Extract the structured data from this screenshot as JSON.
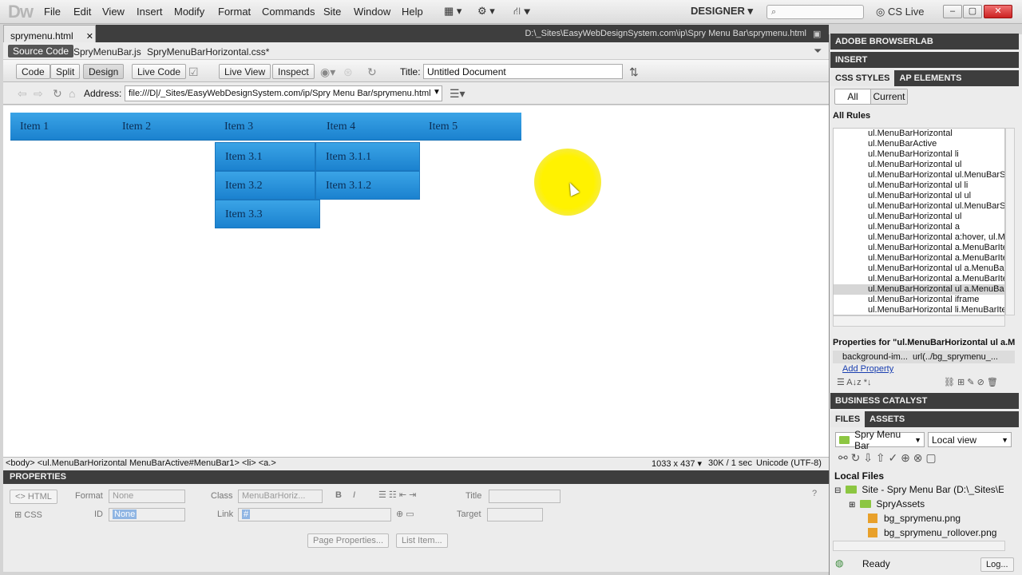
{
  "menubar": {
    "logo": "Dw",
    "items": [
      "File",
      "Edit",
      "View",
      "Insert",
      "Modify",
      "Format",
      "Commands",
      "Site",
      "Window",
      "Help"
    ],
    "workspace": "DESIGNER",
    "cslive": "CS Live"
  },
  "document": {
    "tab": "sprymenu.html",
    "path": "D:\\_Sites\\EasyWebDesignSystem.com\\ip\\Spry Menu Bar\\sprymenu.html",
    "related": [
      "Source Code",
      "SpryMenuBar.js",
      "SpryMenuBarHorizontal.css*"
    ],
    "toolbar": {
      "buttons": [
        "Code",
        "Split",
        "Design",
        "Live Code",
        "Live View",
        "Inspect"
      ],
      "title_label": "Title:",
      "title_value": "Untitled Document"
    },
    "address_label": "Address:",
    "address_value": "file:///D|/_Sites/EasyWebDesignSystem.com/ip/Spry Menu Bar/sprymenu.html"
  },
  "spry_menu": {
    "top": [
      "Item 1",
      "Item 2",
      "Item 3",
      "Item 4",
      "Item 5"
    ],
    "sub3": [
      "Item 3.1",
      "Item 3.2",
      "Item 3.3"
    ],
    "sub31": [
      "Item 3.1.1",
      "Item 3.1.2"
    ]
  },
  "status": {
    "tag_selector": "<body> <ul.MenuBarHorizontal MenuBarActive#MenuBar1> <li> <a.>",
    "size": "1033 x 437",
    "weight": "30K / 1 sec",
    "encoding": "Unicode (UTF-8)"
  },
  "properties": {
    "title": "PROPERTIES",
    "html_btn": "HTML",
    "css_btn": "CSS",
    "format_label": "Format",
    "format_value": "None",
    "id_label": "ID",
    "id_value": "None",
    "class_label": "Class",
    "class_value": "MenuBarHoriz...",
    "link_label": "Link",
    "link_value": "#",
    "title_label": "Title",
    "target_label": "Target",
    "page_props_btn": "Page Properties...",
    "list_item_btn": "List Item..."
  },
  "right_panel": {
    "browserlab": "ADOBE BROWSERLAB",
    "insert": "INSERT",
    "css_styles_tab": "CSS STYLES",
    "ap_elements_tab": "AP ELEMENTS",
    "all_btn": "All",
    "current_btn": "Current",
    "all_rules": "All Rules",
    "rules": [
      "ul.MenuBarHorizontal",
      "ul.MenuBarActive",
      "ul.MenuBarHorizontal li",
      "ul.MenuBarHorizontal ul",
      "ul.MenuBarHorizontal ul.MenuBarSu",
      "ul.MenuBarHorizontal ul li",
      "ul.MenuBarHorizontal ul ul",
      "ul.MenuBarHorizontal ul.MenuBarSu",
      "ul.MenuBarHorizontal ul",
      "ul.MenuBarHorizontal a",
      "ul.MenuBarHorizontal a:hover, ul.M",
      "ul.MenuBarHorizontal a.MenuBarIte",
      "ul.MenuBarHorizontal a.MenuBarIte",
      "ul.MenuBarHorizontal ul a.MenuBar",
      "ul.MenuBarHorizontal a.MenuBarIte",
      "ul.MenuBarHorizontal ul a.MenuBar",
      "ul.MenuBarHorizontal iframe",
      "ul.MenuBarHorizontal li.MenuBarIte"
    ],
    "props_for": "Properties for \"ul.MenuBarHorizontal ul a.M...",
    "prop_name": "background-im...",
    "prop_value": "url(../bg_sprymenu_...",
    "add_property": "Add Property",
    "business_catalyst": "BUSINESS CATALYST",
    "files_tab": "FILES",
    "assets_tab": "ASSETS",
    "site_select": "Spry Menu Bar",
    "view_select": "Local view",
    "local_files": "Local Files",
    "tree": [
      "Site - Spry Menu Bar (D:\\_Sites\\Ea",
      "SpryAssets",
      "bg_sprymenu.png",
      "bg_sprymenu_rollover.png"
    ],
    "ready": "Ready",
    "log_btn": "Log..."
  },
  "colors": {
    "menu_blue": "#2a92dc",
    "highlight": "#fff200"
  }
}
